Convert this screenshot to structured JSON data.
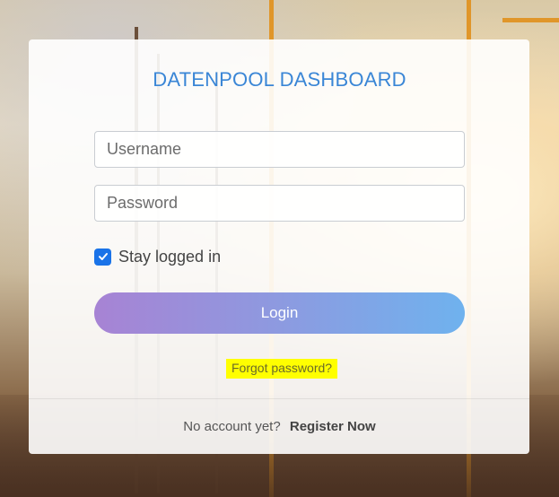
{
  "login": {
    "title": "DATENPOOL DASHBOARD",
    "username_placeholder": "Username",
    "password_placeholder": "Password",
    "stay_logged_in_label": "Stay logged in",
    "stay_logged_in_checked": true,
    "login_button": "Login",
    "forgot_password": "Forgot password?",
    "no_account_text": "No account yet?",
    "register_link": "Register Now"
  },
  "colors": {
    "title": "#3a86d6",
    "checkbox": "#1a73e8",
    "button_gradient_start": "#a783d4",
    "button_gradient_end": "#6fb2ee",
    "forgot_highlight": "#ffff00"
  },
  "icons": {
    "checkbox_mark": "check-icon"
  }
}
